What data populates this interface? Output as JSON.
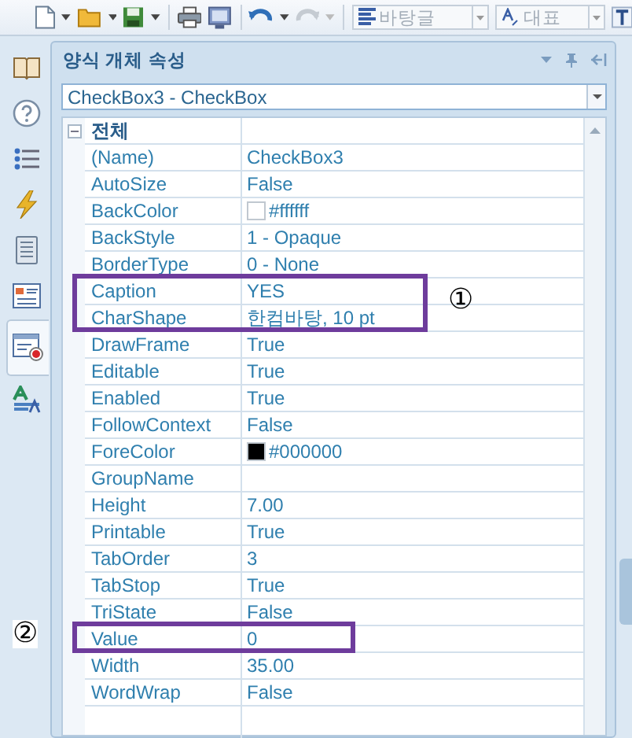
{
  "toolbar": {
    "style_combo": "바탕글",
    "lang_combo": "대표"
  },
  "sidebar": {
    "items": [
      {
        "kind": "book",
        "selected": false
      },
      {
        "kind": "help",
        "selected": false
      },
      {
        "kind": "list",
        "selected": false
      },
      {
        "kind": "bolt",
        "selected": false
      },
      {
        "kind": "page",
        "selected": false
      },
      {
        "kind": "form",
        "selected": false
      },
      {
        "kind": "record",
        "selected": true
      },
      {
        "kind": "style",
        "selected": false
      }
    ]
  },
  "panel": {
    "title": "양식 개체 속성",
    "object_select": "CheckBox3 - CheckBox"
  },
  "grid": {
    "category": "전체",
    "expanded": true,
    "rows": [
      {
        "name": "(Name)",
        "value": "CheckBox3"
      },
      {
        "name": "AutoSize",
        "value": "False"
      },
      {
        "name": "BackColor",
        "value": "#ffffff",
        "color": "#ffffff"
      },
      {
        "name": "BackStyle",
        "value": "1 - Opaque"
      },
      {
        "name": "BorderType",
        "value": "0 - None"
      },
      {
        "name": "Caption",
        "value": "YES",
        "boxed": true
      },
      {
        "name": "CharShape",
        "value": "한컴바탕, 10 pt",
        "boxed": true
      },
      {
        "name": "DrawFrame",
        "value": "True"
      },
      {
        "name": "Editable",
        "value": "True"
      },
      {
        "name": "Enabled",
        "value": "True"
      },
      {
        "name": "FollowContext",
        "value": "False"
      },
      {
        "name": "ForeColor",
        "value": "#000000",
        "color": "#000000"
      },
      {
        "name": "GroupName"
      },
      {
        "name": "Height",
        "value": "7.00"
      },
      {
        "name": "Printable",
        "value": "True"
      },
      {
        "name": "TabOrder",
        "value": "3"
      },
      {
        "name": "TabStop",
        "value": "True"
      },
      {
        "name": "TriState",
        "value": "False"
      },
      {
        "name": "Value",
        "value": "0",
        "boxed": true
      },
      {
        "name": "Width",
        "value": "35.00"
      },
      {
        "name": "WordWrap",
        "value": "False"
      }
    ]
  },
  "annotations": [
    {
      "marker": "①",
      "kind": "right"
    },
    {
      "marker": "②",
      "kind": "left"
    }
  ]
}
